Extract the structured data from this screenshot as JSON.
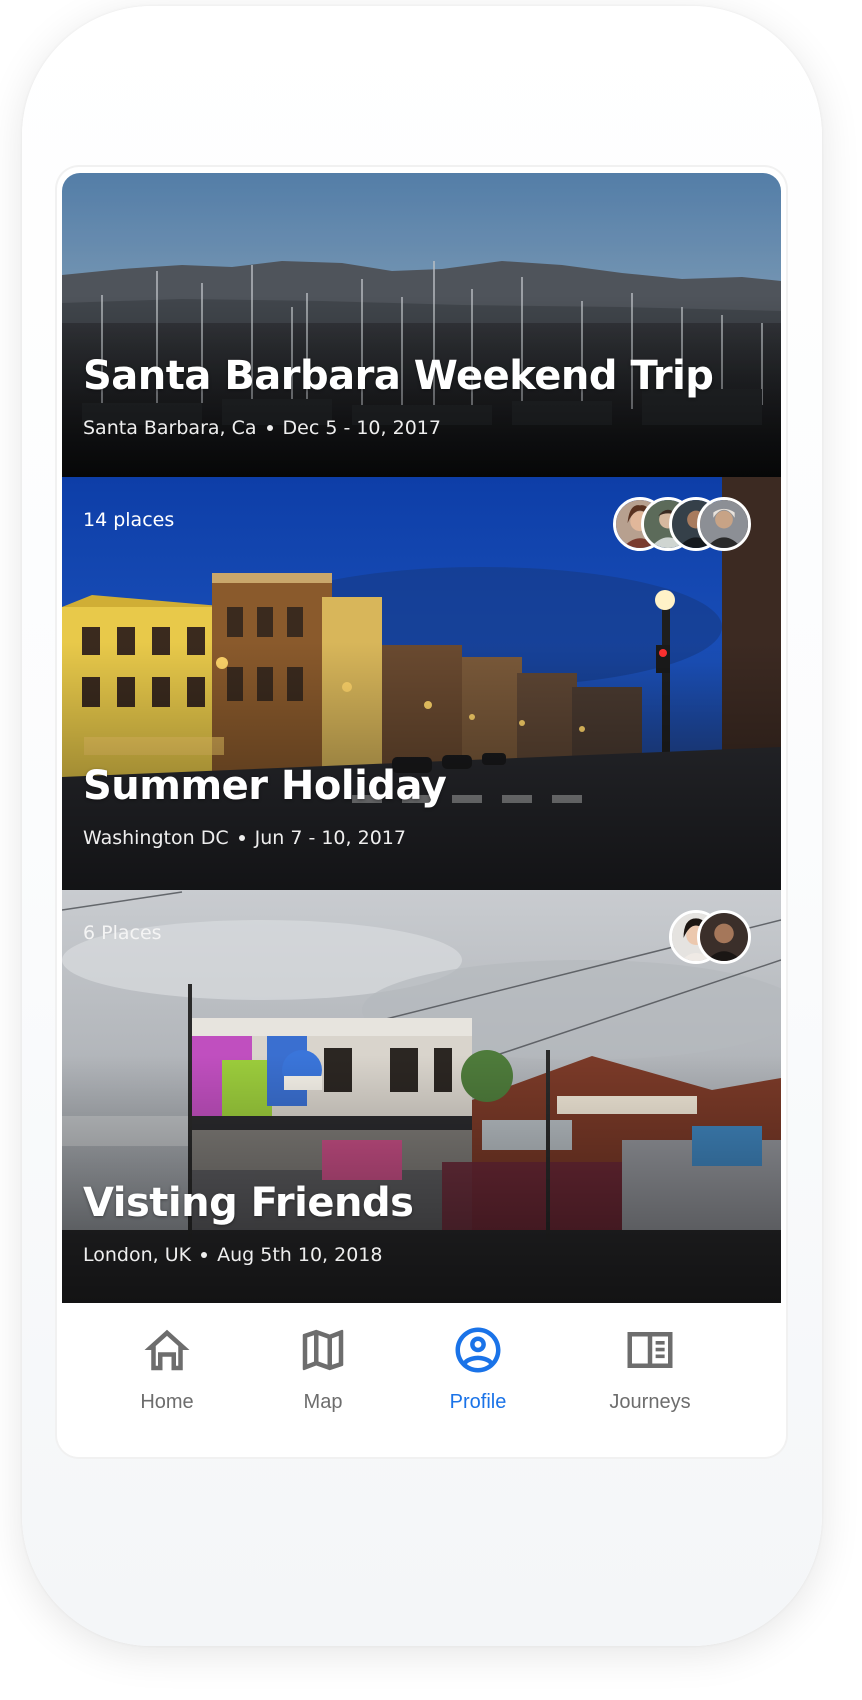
{
  "cards": [
    {
      "title": "Santa Barbara Weekend Trip",
      "location": "Santa Barbara, Ca",
      "dates": "Dec 5 - 10, 2017"
    },
    {
      "places": "14 places",
      "title": "Summer Holiday",
      "location": "Washington DC",
      "dates": "Jun 7 - 10, 2017",
      "collaborators": 4
    },
    {
      "places": "6 Places",
      "title": "Visting Friends",
      "location": "London, UK",
      "dates": "Aug 5th 10, 2018",
      "collaborators": 2
    }
  ],
  "nav": {
    "items": [
      {
        "label": "Home",
        "icon": "home-icon"
      },
      {
        "label": "Map",
        "icon": "map-icon"
      },
      {
        "label": "Profile",
        "icon": "account-circle-icon"
      },
      {
        "label": "Journeys",
        "icon": "journal-icon"
      }
    ],
    "active": "Profile"
  },
  "colors": {
    "accent": "#1a73e8",
    "nav_inactive": "#6d6d6d"
  }
}
